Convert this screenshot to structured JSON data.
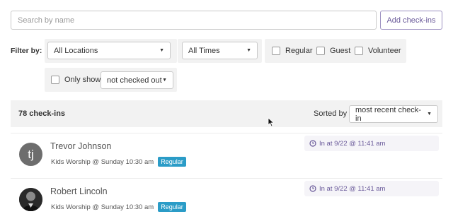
{
  "search": {
    "placeholder": "Search by name"
  },
  "add_button_label": "Add check-ins",
  "filters": {
    "label": "Filter by:",
    "location": "All Locations",
    "time": "All Times",
    "kinds": [
      "Regular",
      "Guest",
      "Volunteer"
    ],
    "only_show_label": "Only show",
    "only_show_value": "not checked out"
  },
  "summary": {
    "count": "78 check-ins",
    "sorted_by_label": "Sorted by",
    "sort_value": "most recent check-in"
  },
  "checkins": [
    {
      "initials": "tj",
      "name": "Trevor Johnson",
      "event": "Kids Worship @ Sunday 10:30 am",
      "badge": "Regular",
      "time": "In at 9/22 @ 11:41 am"
    },
    {
      "initials": "",
      "name": "Robert Lincoln",
      "event": "Kids Worship @ Sunday 10:30 am",
      "badge": "Regular",
      "time": "In at 9/22 @ 11:41 am"
    }
  ],
  "colors": {
    "accent": "#6a5a9a",
    "badge": "#2b9cc7",
    "panel": "#f2f2f2"
  },
  "icons": [
    "clock-icon",
    "caret-down-icon",
    "cursor-icon"
  ]
}
